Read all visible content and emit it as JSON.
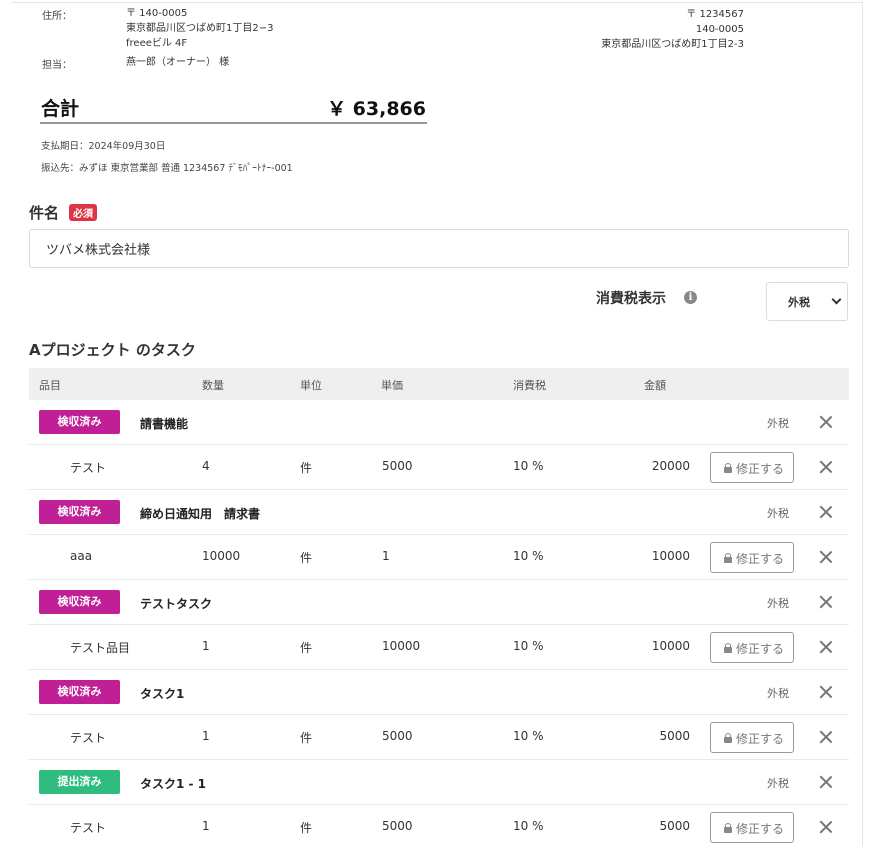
{
  "recipient": {
    "address_label": "住所：",
    "address_lines": [
      "〒 140-0005",
      "東京都品川区つばめ町1丁目2−3",
      "freeeビル 4F"
    ],
    "contact_label": "担当：",
    "contact": "燕一郎（オーナー） 様"
  },
  "issuer": {
    "lines": [
      "〒 1234567",
      "140-0005",
      "東京都品川区つばめ町1丁目2-3"
    ]
  },
  "total": {
    "label": "合計",
    "value": "￥ 63,866"
  },
  "payment": {
    "due": "支払期日：2024年09月30日",
    "bank": "振込先：みずほ 東京営業部 普通 1234567 ﾃﾞﾓﾊﾟｰﾄﾅｰ-001"
  },
  "subject": {
    "label": "件名",
    "required": "必須",
    "value": "ツバメ株式会社様"
  },
  "tax_display": {
    "label": "消費税表示",
    "info_icon": "info-icon",
    "selected": "外税"
  },
  "section_title": "Aプロジェクト のタスク",
  "columns": [
    "品目",
    "数量",
    "単位",
    "単価",
    "消費税",
    "金額"
  ],
  "edit_label": "修正する",
  "colors": {
    "inspected": "#c01f96",
    "submitted": "#2ebd7f",
    "required": "#dc3545"
  },
  "groups": [
    {
      "status": "検収済み",
      "status_type": "inspected",
      "name": "請書機能",
      "tax": "外税",
      "item": {
        "name": "テスト",
        "qty": "4",
        "unit": "件",
        "price": "5000",
        "tax": "10 %",
        "amount": "20000"
      }
    },
    {
      "status": "検収済み",
      "status_type": "inspected",
      "name": "締め日通知用　請求書",
      "tax": "外税",
      "item": {
        "name": "aaa",
        "qty": "10000",
        "unit": "件",
        "price": "1",
        "tax": "10 %",
        "amount": "10000"
      }
    },
    {
      "status": "検収済み",
      "status_type": "inspected",
      "name": "テストタスク",
      "tax": "外税",
      "item": {
        "name": "テスト品目",
        "qty": "1",
        "unit": "件",
        "price": "10000",
        "tax": "10 %",
        "amount": "10000"
      }
    },
    {
      "status": "検収済み",
      "status_type": "inspected",
      "name": "タスク1",
      "tax": "外税",
      "item": {
        "name": "テスト",
        "qty": "1",
        "unit": "件",
        "price": "5000",
        "tax": "10 %",
        "amount": "5000"
      }
    },
    {
      "status": "提出済み",
      "status_type": "submitted",
      "name": "タスク1 - 1",
      "tax": "外税",
      "item": {
        "name": "テスト",
        "qty": "1",
        "unit": "件",
        "price": "5000",
        "tax": "10 %",
        "amount": "5000"
      }
    }
  ]
}
